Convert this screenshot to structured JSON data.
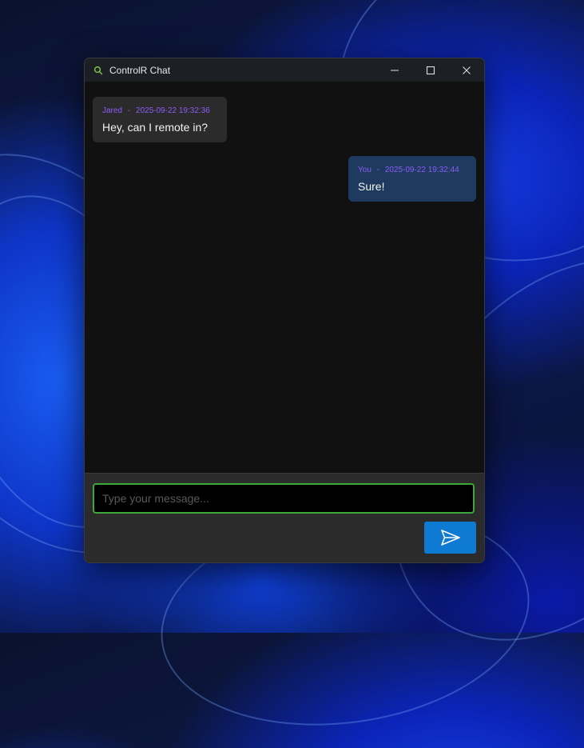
{
  "window": {
    "title": "ControlR Chat",
    "controls": [
      "minimize-icon",
      "maximize-icon",
      "close-icon"
    ]
  },
  "messages": [
    {
      "sender": "Jared",
      "separator": "-",
      "timestamp": "2025-09-22 19:32:36",
      "text": "Hey, can I remote in?",
      "direction": "incoming"
    },
    {
      "sender": "You",
      "separator": "-",
      "timestamp": "2025-09-22 19:32:44",
      "text": "Sure!",
      "direction": "outgoing"
    }
  ],
  "composer": {
    "placeholder": "Type your message...",
    "value": "",
    "send_icon": "send-icon"
  },
  "colors": {
    "meta_text": "#8b5cf6",
    "incoming_bubble": "#2b2b2b",
    "outgoing_bubble": "#1e3a5f",
    "input_focus_border": "#3ca83c",
    "send_button": "#0e7ad1",
    "app_icon": "#7cc04a"
  }
}
